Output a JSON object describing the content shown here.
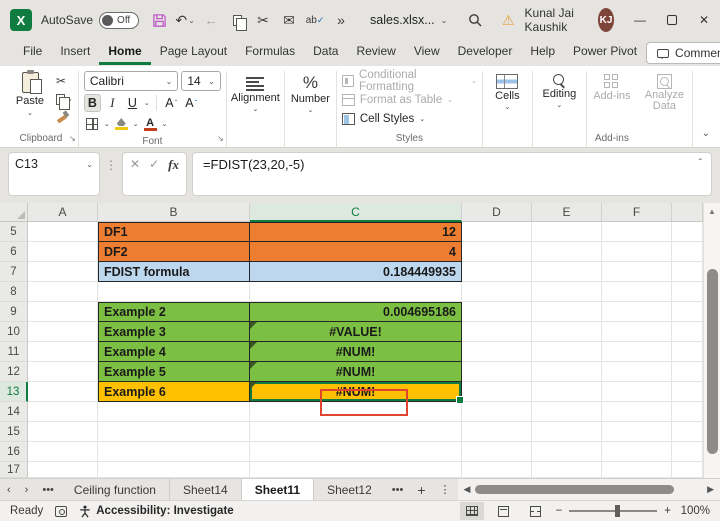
{
  "titlebar": {
    "app_letter": "X",
    "autosave_label": "AutoSave",
    "autosave_state": "Off",
    "filename": "sales.xlsx...",
    "user_name": "Kunal Jai Kaushik",
    "user_initials": "KJ"
  },
  "tabs": {
    "items": [
      "File",
      "Insert",
      "Home",
      "Page Layout",
      "Formulas",
      "Data",
      "Review",
      "View",
      "Developer",
      "Help",
      "Power Pivot"
    ],
    "active": "Home",
    "comments_label": "Comments"
  },
  "ribbon": {
    "paste_label": "Paste",
    "clipboard_group": "Clipboard",
    "font_name": "Calibri",
    "font_size": "14",
    "bold": "B",
    "italic": "I",
    "underline": "U",
    "font_group": "Font",
    "alignment_label": "Alignment",
    "number_label": "Number",
    "conditional_formatting": "Conditional Formatting",
    "format_as_table": "Format as Table",
    "cell_styles": "Cell Styles",
    "styles_group": "Styles",
    "cells_label": "Cells",
    "editing_label": "Editing",
    "addins_label": "Add-ins",
    "analyze_data_label": "Analyze Data",
    "addins_group": "Add-ins"
  },
  "formula_bar": {
    "name_box": "C13",
    "fx": "fx",
    "formula": "=FDIST(23,20,-5)"
  },
  "sheet": {
    "columns": [
      "A",
      "B",
      "C",
      "D",
      "E",
      "F"
    ],
    "rows": [
      "5",
      "6",
      "7",
      "8",
      "9",
      "10",
      "11",
      "12",
      "13",
      "14",
      "15",
      "16",
      "17"
    ],
    "selected_cell": "C13",
    "table1": [
      {
        "label": "DF1",
        "value": "12"
      },
      {
        "label": "DF2",
        "value": "4"
      },
      {
        "label": "FDIST formula",
        "value": "0.184449935"
      }
    ],
    "table2": [
      {
        "label": "Example 2",
        "value": "0.004695186"
      },
      {
        "label": "Example 3",
        "value": "#VALUE!"
      },
      {
        "label": "Example 4",
        "value": "#NUM!"
      },
      {
        "label": "Example 5",
        "value": "#NUM!"
      },
      {
        "label": "Example 6",
        "value": "#NUM!"
      }
    ]
  },
  "sheet_tabs": {
    "items": [
      "Ceiling function",
      "Sheet14",
      "Sheet11",
      "Sheet12"
    ],
    "active": "Sheet11"
  },
  "status_bar": {
    "ready": "Ready",
    "accessibility": "Accessibility: Investigate",
    "zoom": "100%"
  },
  "colors": {
    "accent_green": "#107C41",
    "orange_fill": "#ED7D31",
    "blue_fill": "#BDD7EE",
    "green_fill": "#7CC043",
    "gold_fill": "#FFC000",
    "annotation_red": "#E0452F"
  }
}
